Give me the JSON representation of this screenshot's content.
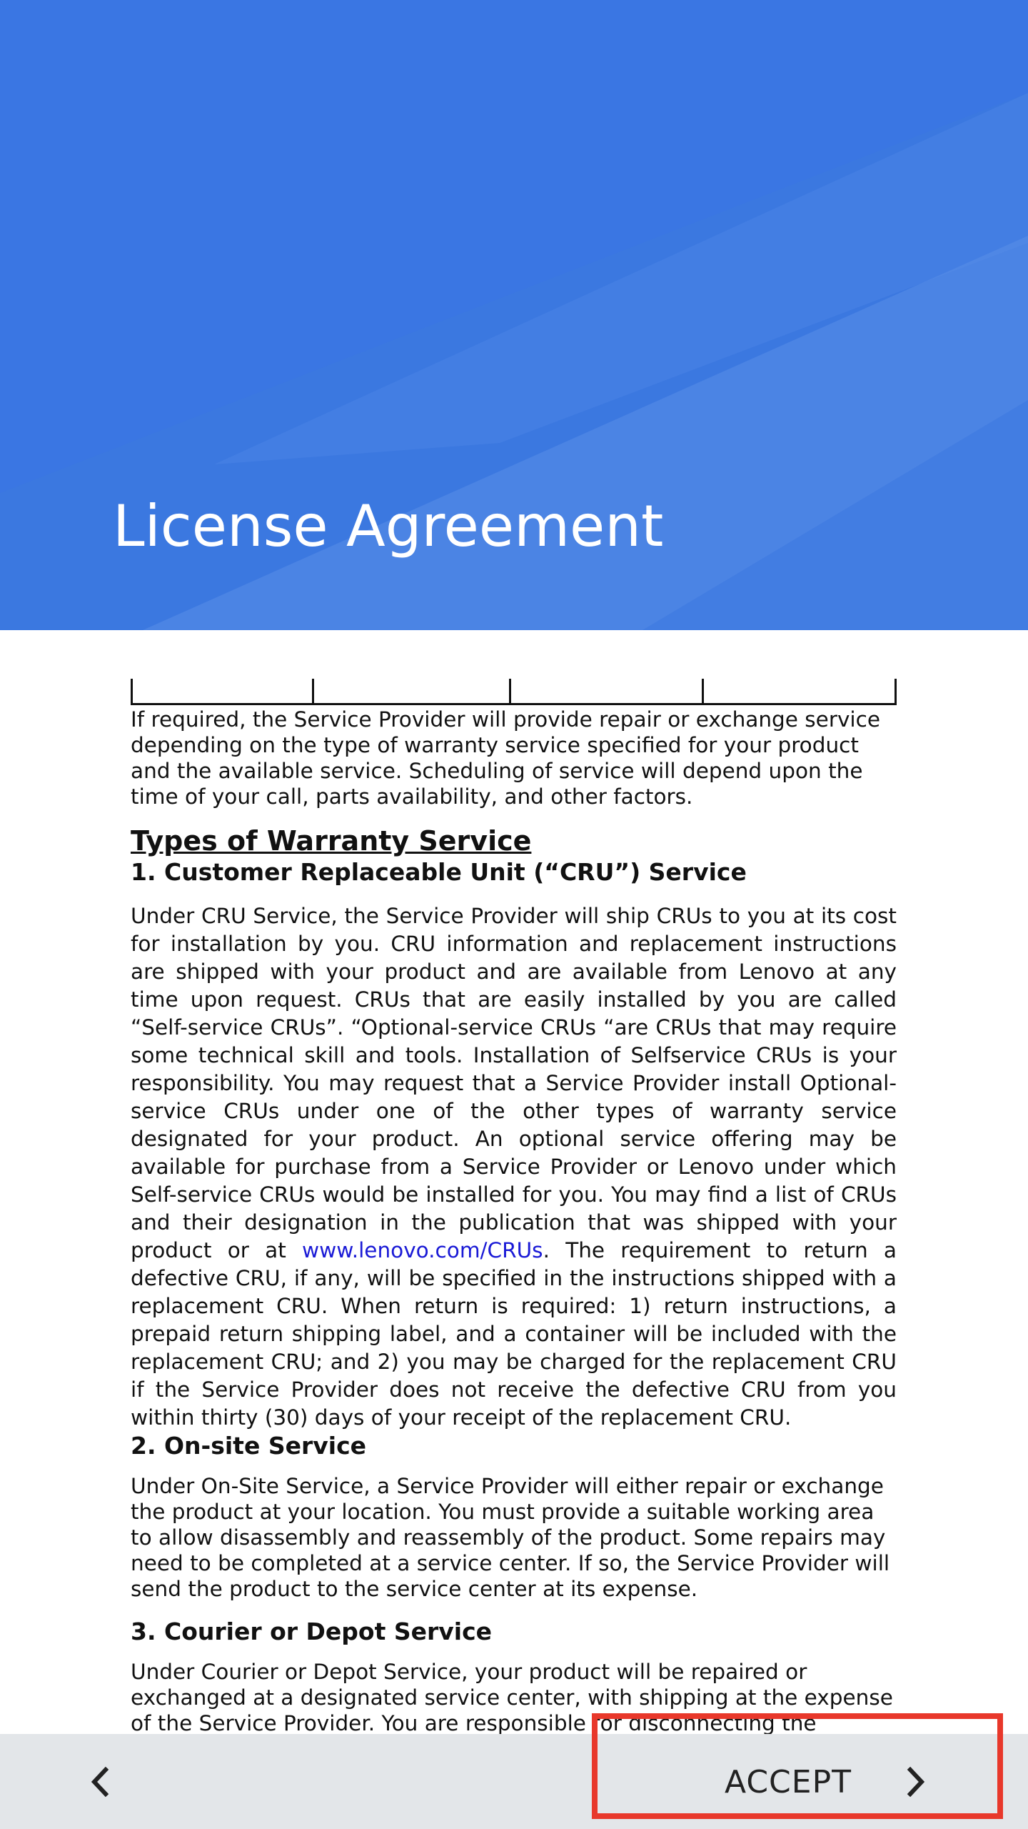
{
  "header": {
    "title": "License Agreement",
    "background_color": "#3b78e0"
  },
  "content": {
    "intro": "If required, the Service Provider will provide repair or exchange service depending on the type of warranty service specified for your product and the available service. Scheduling of service will depend upon the time of your call, parts availability, and other factors.",
    "section_title": "Types of Warranty Service",
    "cru": {
      "heading": "1. Customer Replaceable Unit (“CRU”) Service",
      "text_part1": "Under CRU Service, the Service Provider will ship CRUs to you at its cost for installation by you. CRU information and replacement instructions are shipped with your product and are available from Lenovo at any time upon request. CRUs that are easily installed by you are called “Self-service CRUs”. “Optional-service CRUs “are CRUs that may require some technical skill and tools. Installation of Selfservice CRUs is your responsibility. You may request that a Service Provider install Optional-service CRUs under one of the other types of warranty service designated for your product. An optional service offering may be available for purchase from a Service Provider or Lenovo under which Self-service CRUs would be installed for you. You may find a list of CRUs and their designation in the publication that was shipped with your product or at ",
      "link_text": "www.lenovo.com/CRUs",
      "text_part2": ". The requirement to return a defective CRU, if any, will be specified in the instructions shipped with a replacement CRU. When return is required: 1) return instructions, a prepaid return shipping label, and a container will be included with the replacement CRU; and 2) you may be charged for the replacement CRU if the Service Provider does not receive the defective CRU from you within thirty (30) days of your receipt of the replacement CRU."
    },
    "onsite": {
      "heading": "2. On-site Service",
      "text": "Under On-Site Service, a Service Provider will either repair or exchange the product at your location. You must provide a suitable working area to allow disassembly and reassembly of the product. Some repairs may need to be completed at a service center. If so, the Service Provider will send the product to the service center at its expense."
    },
    "courier": {
      "heading": "3. Courier or Depot Service",
      "text": "Under Courier or Depot Service, your product will be repaired or exchanged at a designated service center, with shipping at the expense of the Service Provider. You are responsible for disconnecting the product"
    },
    "link_color": "#1a1ad6"
  },
  "bottom_bar": {
    "back_icon": "chevron-left-icon",
    "accept_label": "ACCEPT",
    "accept_icon": "chevron-right-icon",
    "background_color": "#e3e6e9",
    "highlight_color": "#e8382b"
  }
}
